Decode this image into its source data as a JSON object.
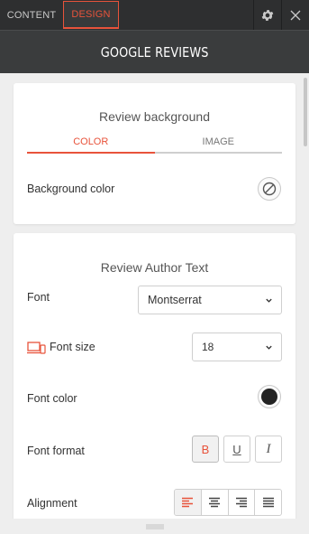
{
  "top_tabs": {
    "content": "CONTENT",
    "design": "DESIGN"
  },
  "header": {
    "title": "GOOGLE REVIEWS"
  },
  "icons": {
    "settings": "gear-icon",
    "close": "close-icon"
  },
  "colors": {
    "accent": "#e8533b",
    "topbar": "#2e2f30",
    "titlebar": "#3a3c3d",
    "font_color_swatch": "#222222"
  },
  "review_background": {
    "title": "Review background",
    "tabs": [
      {
        "label": "COLOR",
        "active": true
      },
      {
        "label": "IMAGE",
        "active": false
      }
    ],
    "background_color_label": "Background color"
  },
  "review_author_text": {
    "title": "Review Author Text",
    "font_label": "Font",
    "font_value": "Montserrat",
    "font_size_label": "Font size",
    "font_size_value": "18",
    "font_color_label": "Font color",
    "font_format_label": "Font format",
    "format_buttons": [
      {
        "label": "B",
        "active": true
      },
      {
        "label": "U",
        "active": false
      },
      {
        "label": "I",
        "active": false
      }
    ],
    "alignment_label": "Alignment",
    "alignment_options": [
      "left",
      "center",
      "right",
      "justify"
    ],
    "alignment_selected": "left"
  }
}
